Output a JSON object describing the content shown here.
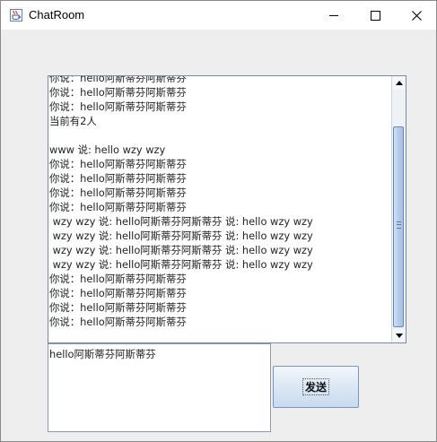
{
  "window": {
    "title": "ChatRoom",
    "icon": "java-coffee-cup-icon"
  },
  "title_buttons": {
    "minimize_icon": "minimize-icon",
    "maximize_icon": "maximize-icon",
    "close_icon": "close-icon",
    "close_glyph": "✕"
  },
  "chat": {
    "lines": [
      "你说：hello阿斯蒂芬阿斯蒂芬",
      "你说：hello阿斯蒂芬阿斯蒂芬",
      "你说：hello阿斯蒂芬阿斯蒂芬",
      "当前有2人",
      "",
      "www 说: hello wzy wzy",
      "你说：hello阿斯蒂芬阿斯蒂芬",
      "你说：hello阿斯蒂芬阿斯蒂芬",
      "你说：hello阿斯蒂芬阿斯蒂芬",
      "你说：hello阿斯蒂芬阿斯蒂芬",
      " wzy wzy 说: hello阿斯蒂芬阿斯蒂芬 说: hello wzy wzy",
      " wzy wzy 说: hello阿斯蒂芬阿斯蒂芬 说: hello wzy wzy",
      " wzy wzy 说: hello阿斯蒂芬阿斯蒂芬 说: hello wzy wzy",
      " wzy wzy 说: hello阿斯蒂芬阿斯蒂芬 说: hello wzy wzy",
      "你说：hello阿斯蒂芬阿斯蒂芬",
      "你说：hello阿斯蒂芬阿斯蒂芬",
      "你说：hello阿斯蒂芬阿斯蒂芬",
      "你说：hello阿斯蒂芬阿斯蒂芬"
    ]
  },
  "input": {
    "value": "hello阿斯蒂芬阿斯蒂芬"
  },
  "send_button": {
    "label": "发送"
  }
}
